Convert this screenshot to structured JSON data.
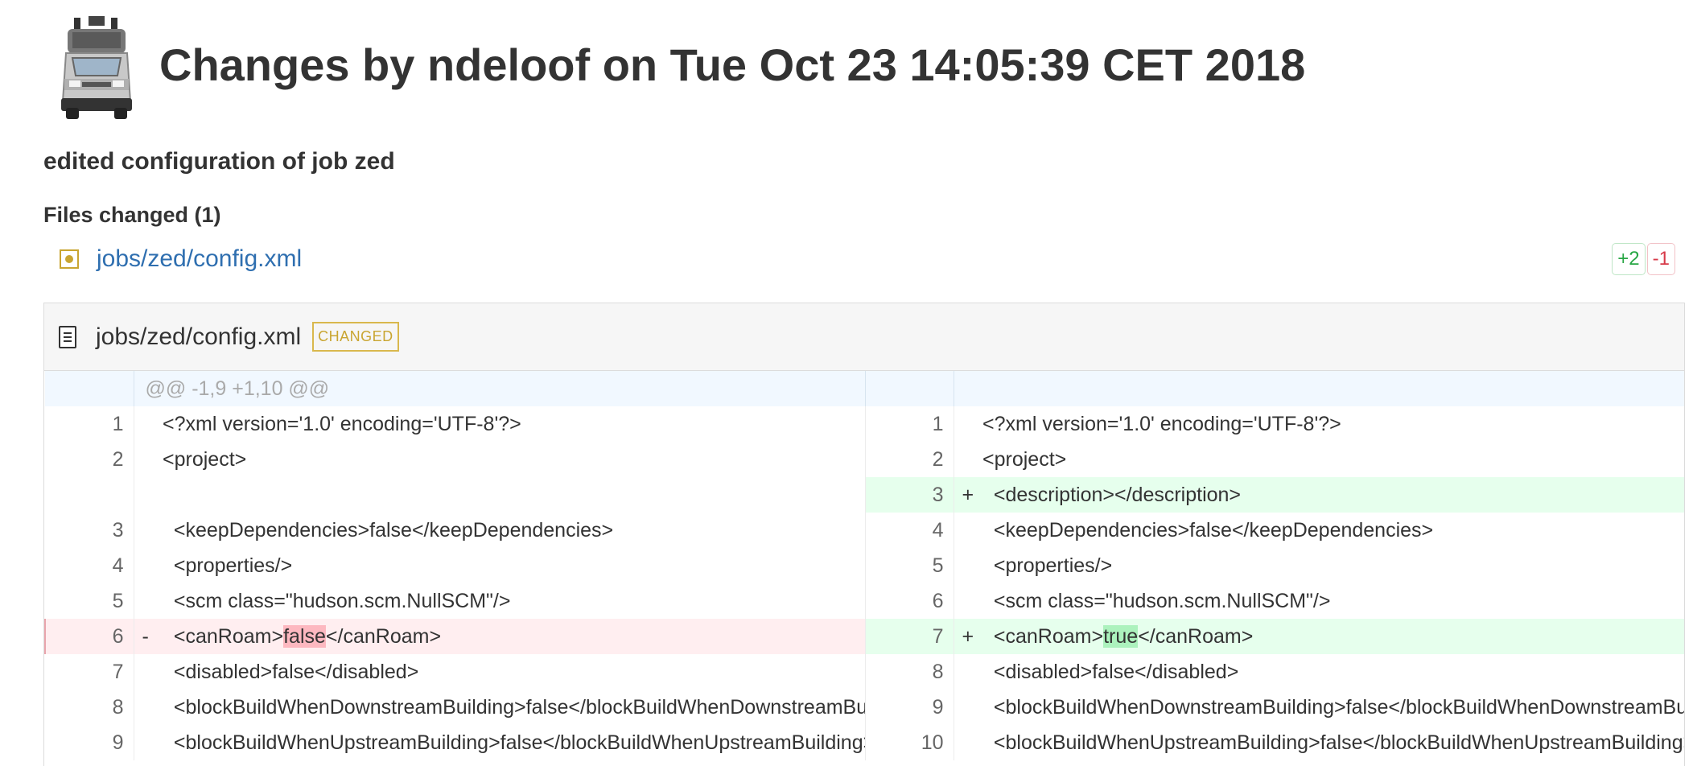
{
  "page": {
    "title": "Changes by ndeloof on Tue Oct 23 14:05:39 CET 2018",
    "subtitle": "edited configuration of job zed",
    "files_heading": "Files changed (1)"
  },
  "logo": {
    "icon": "jenkins-delorean-logo"
  },
  "files": [
    {
      "path": "jobs/zed/config.xml",
      "icon": "file-changed-icon",
      "additions": "+2",
      "deletions": "-1"
    }
  ],
  "diff": {
    "filename": "jobs/zed/config.xml",
    "badge": "CHANGED",
    "hunk": "@@ -1,9 +1,10 @@",
    "rows": [
      {
        "type": "context",
        "left_num": "1",
        "left_code": "<?xml version='1.0' encoding='UTF-8'?>",
        "right_num": "1",
        "right_code": "<?xml version='1.0' encoding='UTF-8'?>"
      },
      {
        "type": "context",
        "left_num": "2",
        "left_code": "<project>",
        "right_num": "2",
        "right_code": "<project>"
      },
      {
        "type": "add",
        "left_num": "",
        "left_code": "",
        "right_num": "3",
        "right_sign": "+",
        "right_code": "  <description></description>"
      },
      {
        "type": "context",
        "left_num": "3",
        "left_code": "  <keepDependencies>false</keepDependencies>",
        "right_num": "4",
        "right_code": "  <keepDependencies>false</keepDependencies>"
      },
      {
        "type": "context",
        "left_num": "4",
        "left_code": "  <properties/>",
        "right_num": "5",
        "right_code": "  <properties/>"
      },
      {
        "type": "context",
        "left_num": "5",
        "left_code": "  <scm class=\"hudson.scm.NullSCM\"/>",
        "right_num": "6",
        "right_code": "  <scm class=\"hudson.scm.NullSCM\"/>"
      },
      {
        "type": "change",
        "left_num": "6",
        "left_sign": "-",
        "left_pre": "  <canRoam>",
        "left_hl": "false",
        "left_post": "</canRoam>",
        "right_num": "7",
        "right_sign": "+",
        "right_pre": "  <canRoam>",
        "right_hl": "true",
        "right_post": "</canRoam>"
      },
      {
        "type": "context",
        "left_num": "7",
        "left_code": "  <disabled>false</disabled>",
        "right_num": "8",
        "right_code": "  <disabled>false</disabled>"
      },
      {
        "type": "context",
        "left_num": "8",
        "left_code": "  <blockBuildWhenDownstreamBuilding>false</blockBuildWhenDownstreamBuilding>",
        "right_num": "9",
        "right_code": "  <blockBuildWhenDownstreamBuilding>false</blockBuildWhenDownstreamBuilding>"
      },
      {
        "type": "context",
        "left_num": "9",
        "left_code": "  <blockBuildWhenUpstreamBuilding>false</blockBuildWhenUpstreamBuilding>",
        "right_num": "10",
        "right_code": "  <blockBuildWhenUpstreamBuilding>false</blockBuildWhenUpstreamBuilding>"
      }
    ]
  },
  "colors": {
    "link": "#2f6fb0",
    "changed": "#c9a531",
    "add": "#e6ffed",
    "add_hl": "#acf2bd",
    "del": "#ffeef0",
    "del_hl": "#fdb8c0"
  }
}
